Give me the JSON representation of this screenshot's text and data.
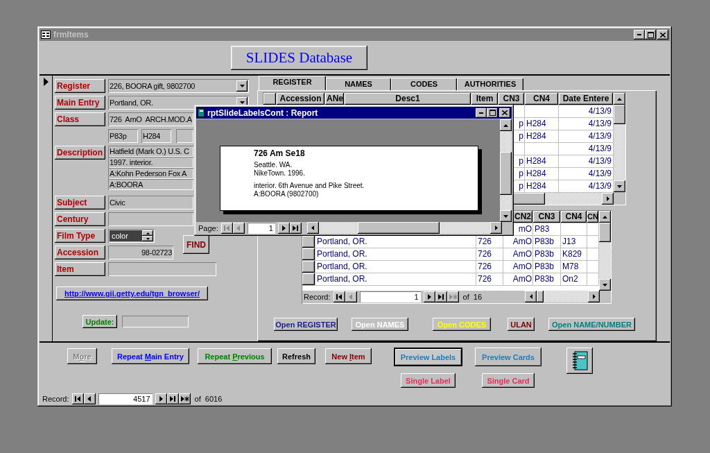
{
  "window": {
    "title": "frmItems"
  },
  "header": {
    "title": "SLIDES Database"
  },
  "fields": [
    {
      "label": "Register",
      "kind": "combo",
      "value": "226, BOORA gift, 9802700",
      "focused": false
    },
    {
      "label": "Main Entry",
      "kind": "combo",
      "value": "Portland, OR.",
      "focused": false
    },
    {
      "label": "Class",
      "kind": "text",
      "value": "726  AmO  ARCH.MOD.A",
      "parts": [
        "P83p",
        "H284"
      ],
      "focused": false
    },
    {
      "label": "Description",
      "kind": "lines",
      "lines": [
        "Hatfield (Mark O.) U.S. C",
        "1997. interior.",
        "A:Kohn Pederson Fox A",
        "A:BOORA"
      ],
      "focused": false
    },
    {
      "label": "Subject",
      "kind": "text",
      "value": "Civic",
      "focused": false
    },
    {
      "label": "Century",
      "kind": "text",
      "focused": false
    },
    {
      "label": "Film Type",
      "kind": "spin",
      "value": "color",
      "focused": true,
      "button": "FIND"
    },
    {
      "label": "Accession",
      "kind": "number",
      "value": "98-02723",
      "focused": false
    },
    {
      "label": "Item",
      "kind": "medium",
      "focused": false
    }
  ],
  "link": "http://www.gii.getty.edu/tgn_browser/",
  "update": {
    "label": "Update:"
  },
  "tabs": [
    {
      "label": "REGISTER",
      "selected": true
    },
    {
      "label": "NAMES",
      "selected": false
    },
    {
      "label": "CODES",
      "selected": false
    },
    {
      "label": "AUTHORITIES",
      "selected": false
    }
  ],
  "top_grid": {
    "columns": [
      "Accession",
      "ANe",
      "Desc1",
      "Item",
      "CN3",
      "CN4",
      "Date Entere"
    ],
    "rows": [
      {
        "date_entered": "4/13/9"
      },
      {
        "cn3": "p",
        "cn4": "H284",
        "date_entered": "4/13/9"
      },
      {
        "cn3": "p",
        "cn4": "H284",
        "date_entered": "4/13/9"
      },
      {
        "date_entered": "4/13/9"
      },
      {
        "cn3": "p",
        "cn4": "H284",
        "date_entered": "4/13/9"
      },
      {
        "cn3": "p",
        "cn4": "H284",
        "date_entered": "4/13/9"
      },
      {
        "cn3": "p",
        "cn4": "H284",
        "date_entered": "4/13/9"
      }
    ]
  },
  "bottom_grid": {
    "columns": [
      "CN2",
      "CN3",
      "CN4",
      "CN"
    ],
    "rows": [
      {
        "cn2": "mO",
        "cn3": "P83"
      },
      {
        "main_entry": "Portland, OR.",
        "cn1": "726",
        "cn2": "AmO",
        "cn3": "P83b",
        "cn4": "J13"
      },
      {
        "main_entry": "Portland, OR.",
        "cn1": "726",
        "cn2": "AmO",
        "cn3": "P83b",
        "cn4": "K829"
      },
      {
        "main_entry": "Portland, OR.",
        "cn1": "726",
        "cn2": "AmO",
        "cn3": "P83b",
        "cn4": "M78"
      },
      {
        "main_entry": "Portland, OR.",
        "cn1": "726",
        "cn2": "AmO",
        "cn3": "P83b",
        "cn4": "On2"
      }
    ],
    "nav": {
      "label": "Record:",
      "value": "1",
      "total": "of  16",
      "buttons": [
        {
          "kind": "first",
          "disabled": false
        },
        {
          "kind": "prev",
          "disabled": true
        },
        {
          "kind": "next",
          "disabled": false
        },
        {
          "kind": "last",
          "disabled": false
        },
        {
          "kind": "new",
          "disabled": true
        }
      ]
    }
  },
  "tab_buttons": [
    {
      "label": "Open REGISTER",
      "color": "#1c1c8c"
    },
    {
      "label": "Open NAMES",
      "color": "#ffffff"
    },
    {
      "label": "Open CODES",
      "color": "#ffff00"
    },
    {
      "label": "ULAN",
      "color": "#800000"
    },
    {
      "label": "Open NAME/NUMBER",
      "color": "#008080"
    }
  ],
  "footer_buttons": [
    {
      "label_start": "M",
      "mnemonic": "o",
      "label_end": "re",
      "color": "#808080",
      "disabled": true
    },
    {
      "label_start": "Repeat ",
      "mnemonic": "M",
      "label_end": "ain Entry",
      "color": "#0000ff",
      "disabled": false
    },
    {
      "label_start": "Repeat ",
      "mnemonic": "P",
      "label_end": "revious",
      "color": "#008000",
      "disabled": false
    },
    {
      "label_start": "Refresh",
      "color": "#000000",
      "disabled": false
    },
    {
      "label_start": "New ",
      "mnemonic": "I",
      "label_end": "tem",
      "color": "#800000",
      "disabled": false
    }
  ],
  "output_groups": [
    {
      "preview": {
        "label": "Preview Labels",
        "focused": true
      },
      "single": {
        "label": "Single Label"
      }
    },
    {
      "preview": {
        "label": "Preview Cards",
        "focused": false
      },
      "single": {
        "label": "Single Card"
      }
    }
  ],
  "record_nav": {
    "label": "Record:",
    "value": "4517",
    "total": "of  6016",
    "buttons": [
      {
        "kind": "first",
        "disabled": false
      },
      {
        "kind": "prev",
        "disabled": false
      },
      {
        "kind": "next",
        "disabled": false
      },
      {
        "kind": "last",
        "disabled": false
      },
      {
        "kind": "new",
        "disabled": false
      }
    ]
  },
  "report": {
    "title": "rptSlideLabelsCont : Report",
    "heading": "726 Am Se18",
    "paragraphs": [
      [
        "Seattle. WA.",
        "NikeTown. 1996."
      ],
      [
        "interior. 6th Avenue and Pike Street.",
        "A:BOORA (9802700)"
      ]
    ],
    "nav": {
      "label": "Page:",
      "value": "1",
      "buttons": [
        {
          "kind": "first",
          "disabled": true
        },
        {
          "kind": "prev",
          "disabled": true
        },
        {
          "kind": "next",
          "disabled": false
        },
        {
          "kind": "last",
          "disabled": false
        }
      ]
    }
  }
}
